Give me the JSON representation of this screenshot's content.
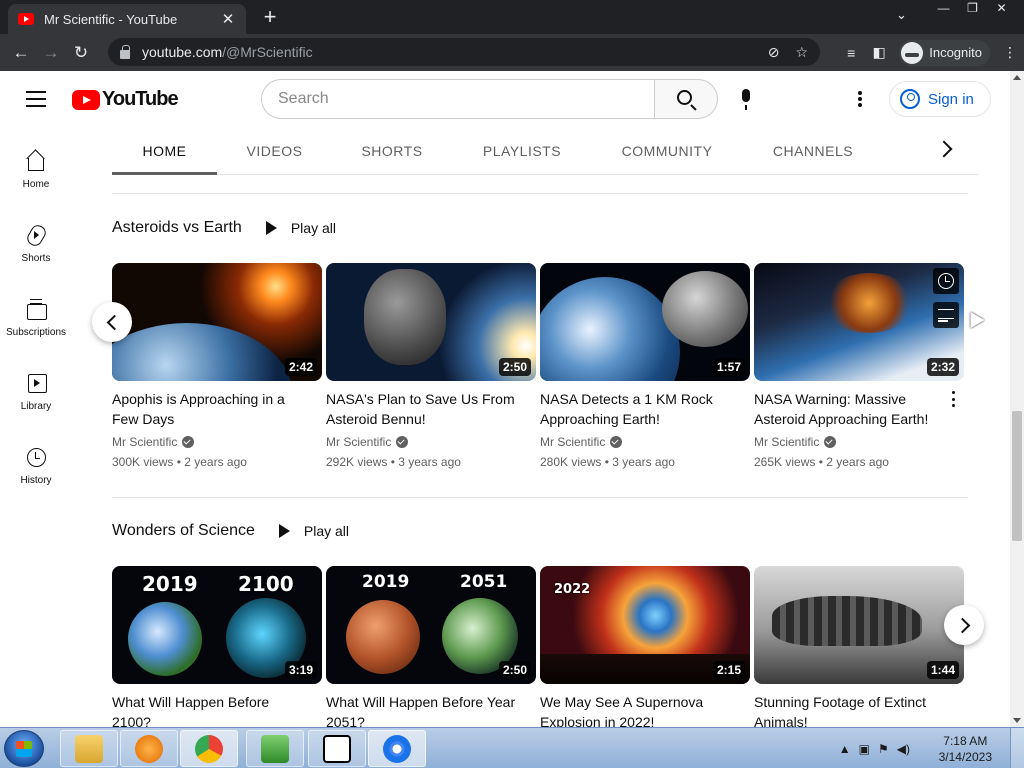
{
  "browser": {
    "tab_title": "Mr Scientific - YouTube",
    "tab_close": "✕",
    "new_tab": "+",
    "tab_dropdown": "⌄",
    "window_minimize": "—",
    "window_restore": "❐",
    "window_close": "✕",
    "back": "←",
    "forward": "→",
    "reload": "↻",
    "url_host": "youtube.com",
    "url_path": "/@MrScientific",
    "incognito_label": "Incognito",
    "menu": "⋮"
  },
  "header": {
    "logo_text": "YouTube",
    "search_placeholder": "Search",
    "signin_label": "Sign in"
  },
  "guide": [
    {
      "label": "Home",
      "icon": "home-icon"
    },
    {
      "label": "Shorts",
      "icon": "shorts-icon"
    },
    {
      "label": "Subscriptions",
      "icon": "subscriptions-icon"
    },
    {
      "label": "Library",
      "icon": "library-icon"
    },
    {
      "label": "History",
      "icon": "history-icon"
    }
  ],
  "channel_tabs": [
    "HOME",
    "VIDEOS",
    "SHORTS",
    "PLAYLISTS",
    "COMMUNITY",
    "CHANNELS"
  ],
  "active_tab": "HOME",
  "shelves": [
    {
      "title": "Asteroids vs Earth",
      "play_all": "Play all",
      "videos": [
        {
          "title": "Apophis is Approaching in a Few Days",
          "channel": "Mr Scientific",
          "views": "300K views",
          "age": "2 years ago",
          "duration": "2:42"
        },
        {
          "title": "NASA's Plan to Save Us From Asteroid Bennu!",
          "channel": "Mr Scientific",
          "views": "292K views",
          "age": "3 years ago",
          "duration": "2:50"
        },
        {
          "title": "NASA Detects a 1 KM Rock Approaching Earth!",
          "channel": "Mr Scientific",
          "views": "280K views",
          "age": "3 years ago",
          "duration": "1:57"
        },
        {
          "title": "NASA Warning: Massive Asteroid Approaching Earth!",
          "channel": "Mr Scientific",
          "views": "265K views",
          "age": "2 years ago",
          "duration": "2:32"
        }
      ]
    },
    {
      "title": "Wonders of Science",
      "play_all": "Play all",
      "videos": [
        {
          "title": "What Will Happen Before 2100?",
          "duration": "3:19",
          "thumb_text": [
            "2019",
            "2100"
          ]
        },
        {
          "title": "What Will Happen Before Year 2051?",
          "duration": "2:50",
          "thumb_text": [
            "2019",
            "2051"
          ]
        },
        {
          "title": "We May See A Supernova Explosion in 2022!",
          "duration": "2:15",
          "thumb_text": [
            "2022"
          ]
        },
        {
          "title": "Stunning Footage of Extinct Animals!",
          "duration": "1:44",
          "thumb_text": []
        }
      ]
    }
  ],
  "taskbar": {
    "time": "7:18 AM",
    "date": "3/14/2023"
  },
  "colors": {
    "youtube_red": "#ff0000",
    "link_blue": "#065fd4",
    "chrome_dark": "#202124",
    "taskbar": "#b9cde6"
  }
}
